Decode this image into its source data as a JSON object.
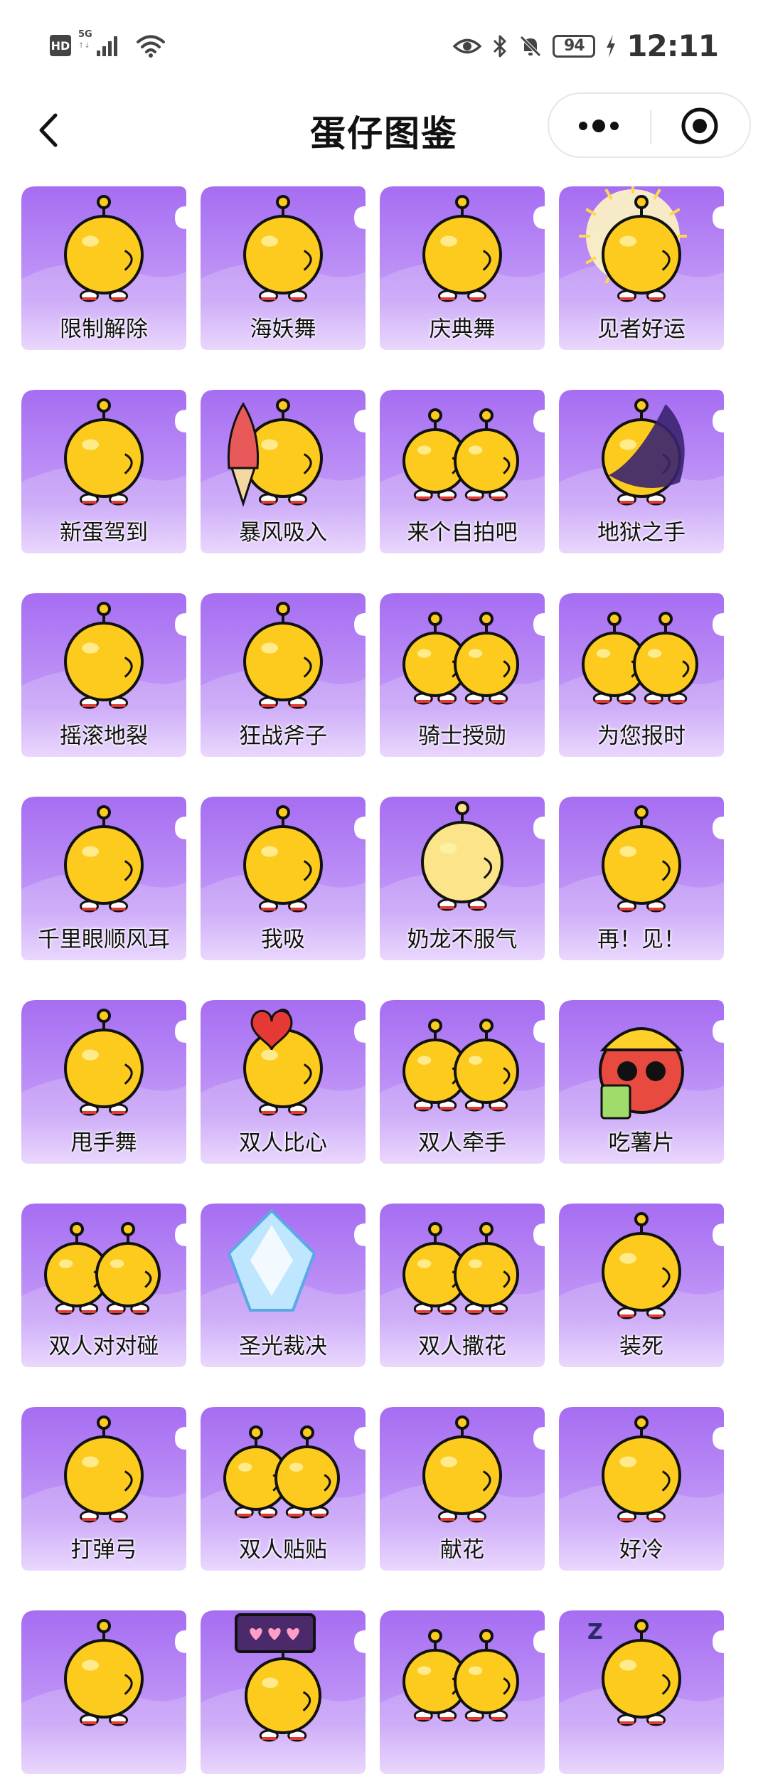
{
  "status_bar": {
    "hd": "HD",
    "network": "5G",
    "network_sub": "↑↓",
    "battery": "94",
    "time": "12:11"
  },
  "nav": {
    "title": "蛋仔图鉴"
  },
  "theme": {
    "card_purple": "#a66df2",
    "card_light": "#e5cffd",
    "egg_yellow": "#fdcb1e"
  },
  "items": [
    {
      "label": "限制解除",
      "prop": "none"
    },
    {
      "label": "海妖舞",
      "prop": "none"
    },
    {
      "label": "庆典舞",
      "prop": "none"
    },
    {
      "label": "见者好运",
      "prop": "halo"
    },
    {
      "label": "新蛋驾到",
      "prop": "none"
    },
    {
      "label": "暴风吸入",
      "prop": "icecream"
    },
    {
      "label": "来个自拍吧",
      "prop": "pair"
    },
    {
      "label": "地狱之手",
      "prop": "dark"
    },
    {
      "label": "摇滚地裂",
      "prop": "none"
    },
    {
      "label": "狂战斧子",
      "prop": "none"
    },
    {
      "label": "骑士授勋",
      "prop": "pair"
    },
    {
      "label": "为您报时",
      "prop": "pair"
    },
    {
      "label": "千里眼顺风耳",
      "prop": "none"
    },
    {
      "label": "我吸",
      "prop": "none"
    },
    {
      "label": "奶龙不服气",
      "prop": "ghost"
    },
    {
      "label": "再！见！",
      "prop": "none"
    },
    {
      "label": "甩手舞",
      "prop": "none"
    },
    {
      "label": "双人比心",
      "prop": "heart"
    },
    {
      "label": "双人牵手",
      "prop": "pair"
    },
    {
      "label": "吃薯片",
      "prop": "red"
    },
    {
      "label": "双人对对碰",
      "prop": "pair"
    },
    {
      "label": "圣光裁决",
      "prop": "crystal"
    },
    {
      "label": "双人撒花",
      "prop": "pair"
    },
    {
      "label": "装死",
      "prop": "none"
    },
    {
      "label": "打弹弓",
      "prop": "none"
    },
    {
      "label": "双人贴贴",
      "prop": "pair"
    },
    {
      "label": "献花",
      "prop": "none"
    },
    {
      "label": "好冷",
      "prop": "none"
    },
    {
      "label": "",
      "prop": "none"
    },
    {
      "label": "",
      "prop": "sign"
    },
    {
      "label": "",
      "prop": "pair"
    },
    {
      "label": "",
      "prop": "sleep"
    }
  ]
}
